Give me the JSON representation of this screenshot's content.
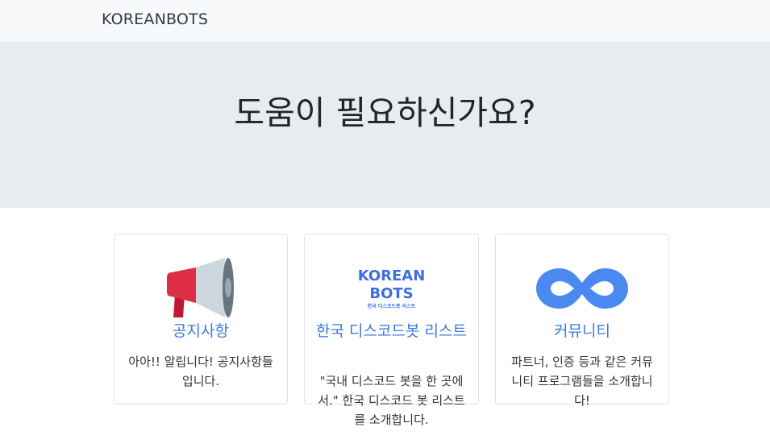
{
  "navbar": {
    "brand": "KOREANBOTS"
  },
  "hero": {
    "title": "도움이 필요하신가요?"
  },
  "cards": [
    {
      "title": "공지사항",
      "text": "아아!! 알립니다! 공지사항들입니다.",
      "icon": "megaphone-icon"
    },
    {
      "title": "한국 디스코드봇 리스트",
      "text": "\"국내 디스코드 봇을 한 곳에서.\" 한국 디스코드 봇 리스트를 소개합니다.",
      "icon": "koreanbots-logo",
      "logo_line1": "KOREAN",
      "logo_line2": "BOTS",
      "logo_sub": "한국 디스코드봇 리스트"
    },
    {
      "title": "커뮤니티",
      "text": "파트너, 인증 등과 같은 커뮤니티 프로그램들을 소개합니다!",
      "icon": "infinity-icon"
    }
  ],
  "colors": {
    "navbar_bg": "#f8f9fa",
    "hero_bg": "#e9ecef",
    "link": "#3b7bd8",
    "logo_blue": "#3b6fe0",
    "infinity_blue": "#4a8af0",
    "megaphone_red": "#dc3545",
    "megaphone_gray": "#ccd6dd"
  }
}
